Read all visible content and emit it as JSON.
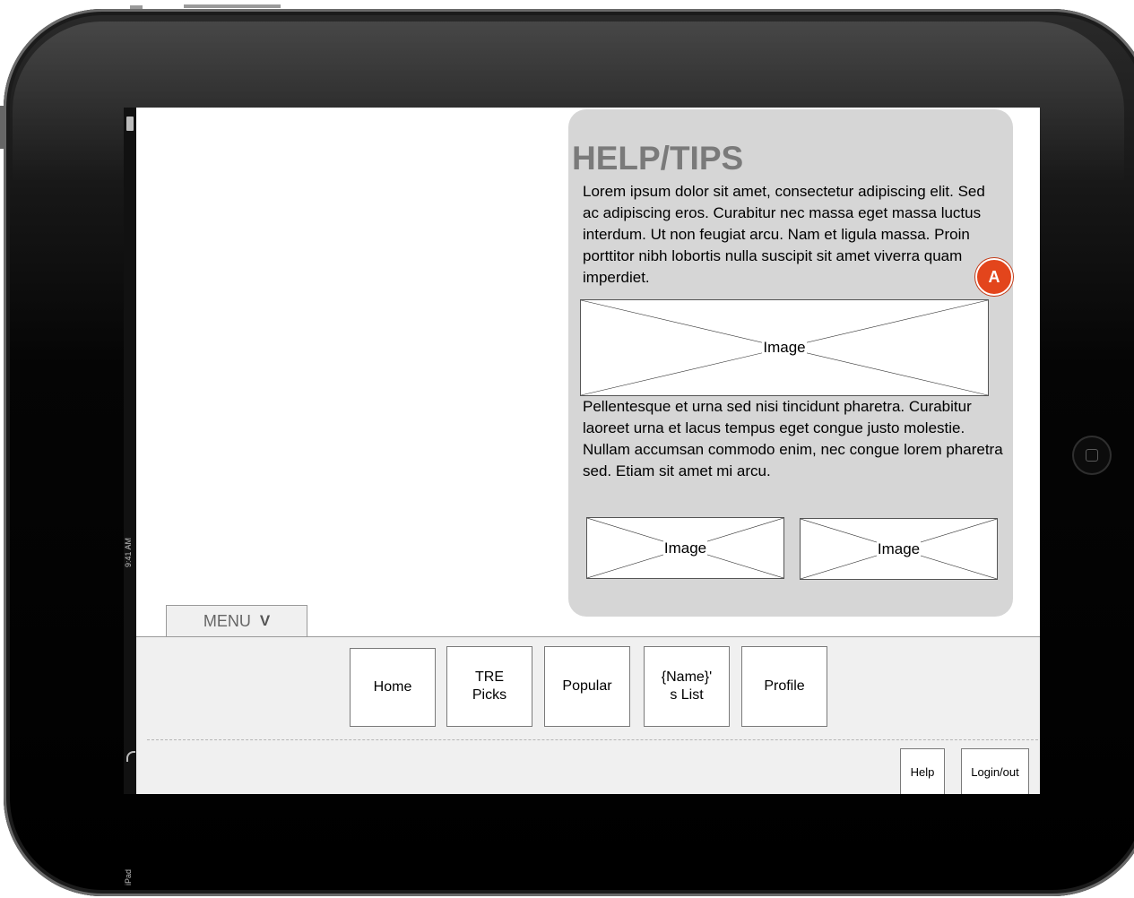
{
  "status_bar": {
    "time": "9:41 AM",
    "device": "iPad"
  },
  "help": {
    "title": "HELP/TIPS",
    "paragraph_1": "Lorem ipsum dolor sit amet, consectetur adipiscing elit. Sed ac adipiscing eros. Curabitur nec massa eget massa luctus interdum. Ut non feugiat arcu. Nam et ligula massa. Proin porttitor nibh lobortis nulla suscipit sit amet viverra quam imperdiet.",
    "paragraph_2": "Pellentesque et urna sed nisi tincidunt pharetra. Curabitur laoreet urna et lacus tempus eget congue justo molestie. Nullam accumsan commodo enim, nec congue lorem pharetra sed. Etiam sit amet mi arcu.",
    "image_large_label": "Image",
    "image_small_1_label": "Image",
    "image_small_2_label": "Image",
    "annotation_badge": "A",
    "badge_color": "#e3451c"
  },
  "menu": {
    "label": "MENU",
    "toggle_glyph": "V"
  },
  "nav": {
    "home": "Home",
    "tre_picks": "TRE\nPicks",
    "popular": "Popular",
    "name_list": "{Name}'\ns List",
    "profile": "Profile"
  },
  "utility": {
    "help": "Help",
    "login": "Login/out"
  }
}
